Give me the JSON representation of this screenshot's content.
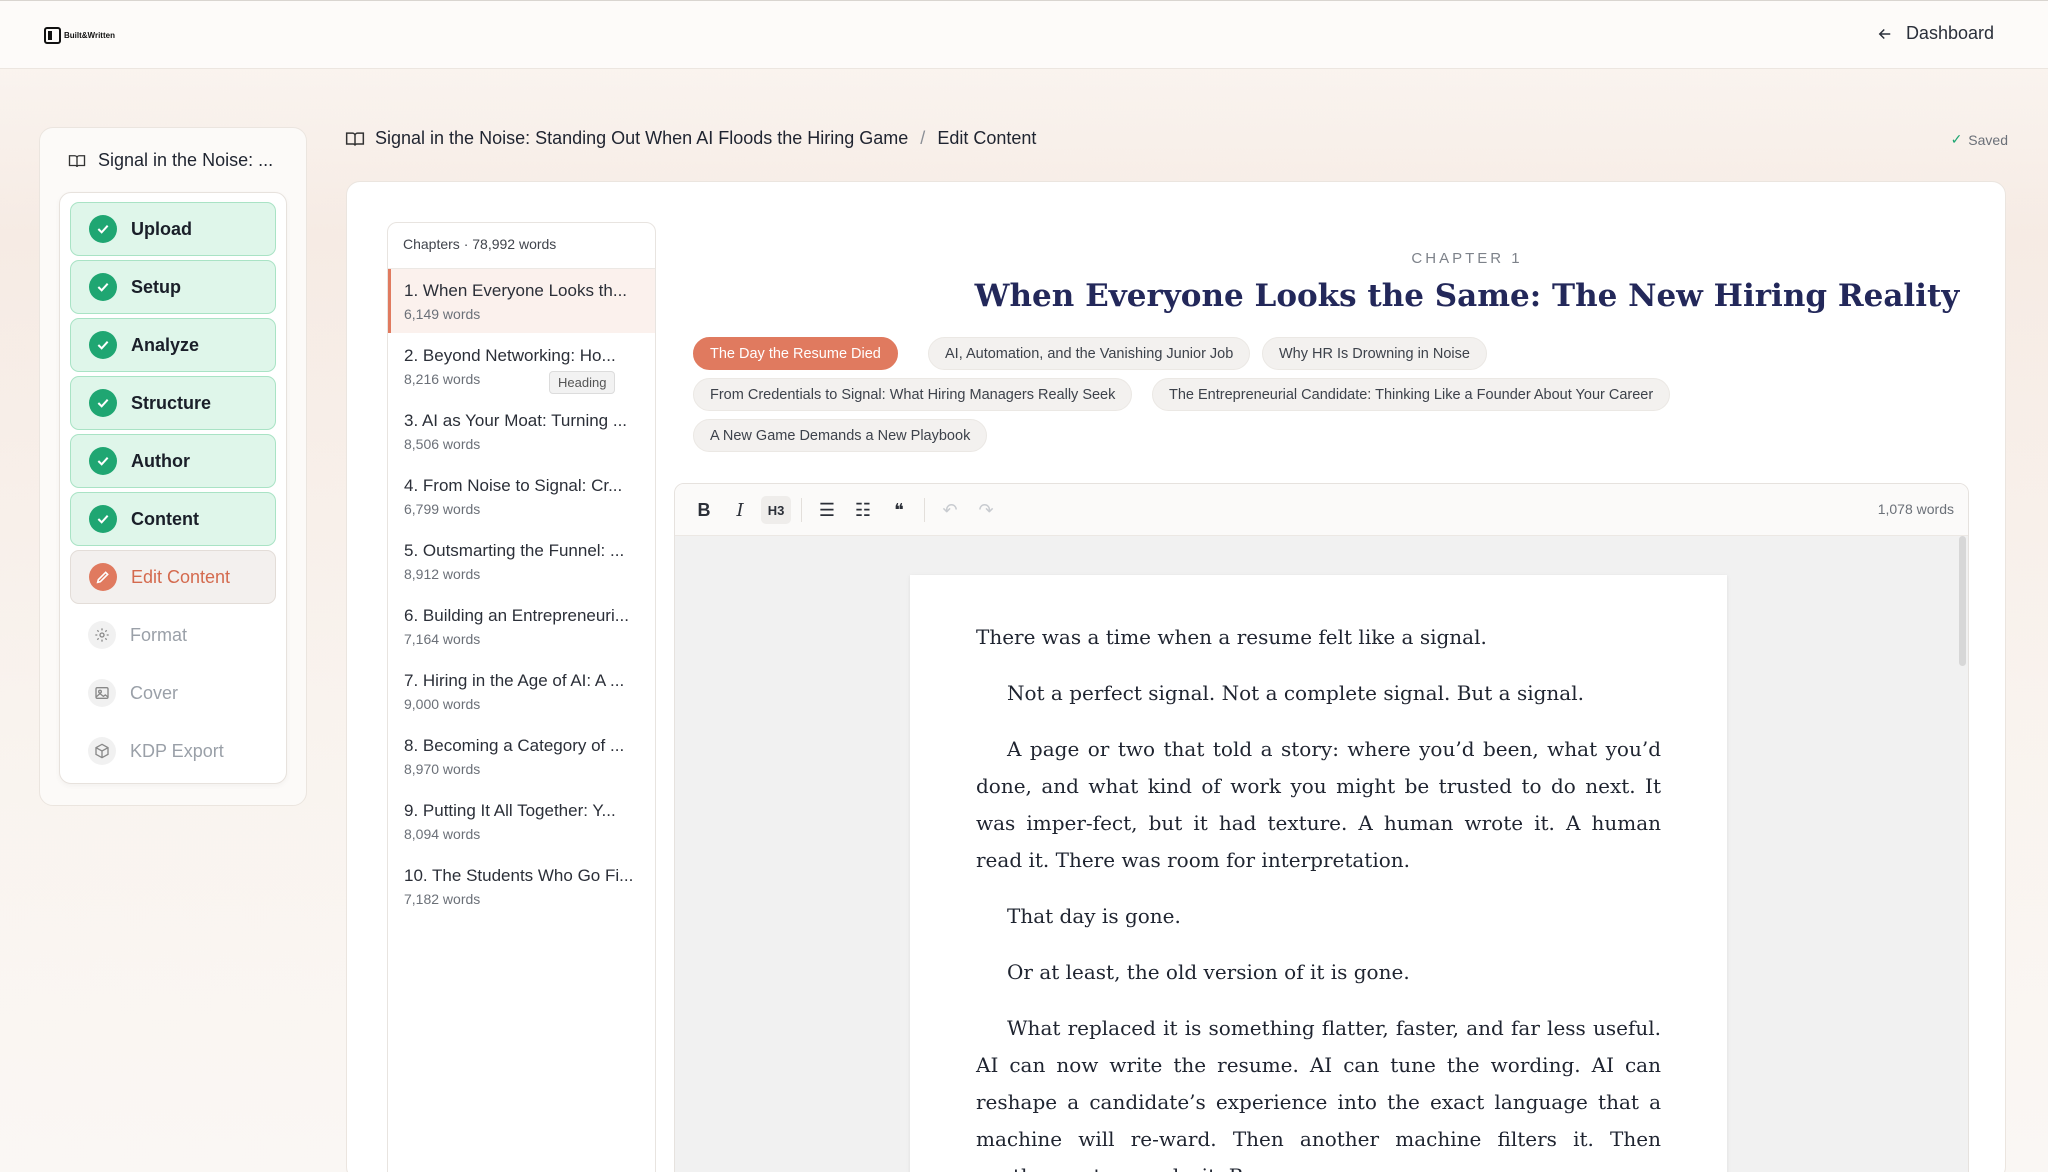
{
  "brand": {
    "name": "Built&Written"
  },
  "topbar": {
    "dashboard_label": "Dashboard"
  },
  "sidebar": {
    "book_title": "Signal in the Noise: ...",
    "steps": [
      {
        "label": "Upload",
        "state": "done"
      },
      {
        "label": "Setup",
        "state": "done"
      },
      {
        "label": "Analyze",
        "state": "done"
      },
      {
        "label": "Structure",
        "state": "done"
      },
      {
        "label": "Author",
        "state": "done"
      },
      {
        "label": "Content",
        "state": "done"
      },
      {
        "label": "Edit Content",
        "state": "active"
      },
      {
        "label": "Format",
        "state": "todo",
        "icon": "gear-icon"
      },
      {
        "label": "Cover",
        "state": "todo",
        "icon": "image-icon"
      },
      {
        "label": "KDP Export",
        "state": "todo",
        "icon": "package-icon"
      }
    ]
  },
  "breadcrumb": {
    "book": "Signal in the Noise: Standing Out When AI Floods the Hiring Game",
    "separator": "/",
    "current": "Edit Content"
  },
  "status": {
    "saved": "Saved"
  },
  "chapters": {
    "header": "Chapters · 78,992 words",
    "items": [
      {
        "title": "1. When Everyone Looks th...",
        "words": "6,149 words"
      },
      {
        "title": "2. Beyond Networking: Ho...",
        "words": "8,216 words"
      },
      {
        "title": "3. AI as Your Moat: Turning ...",
        "words": "8,506 words"
      },
      {
        "title": "4. From Noise to Signal: Cr...",
        "words": "6,799 words"
      },
      {
        "title": "5. Outsmarting the Funnel: ...",
        "words": "8,912 words"
      },
      {
        "title": "6. Building an Entrepreneuri...",
        "words": "7,164 words"
      },
      {
        "title": "7. Hiring in the Age of AI: A ...",
        "words": "9,000 words"
      },
      {
        "title": "8. Becoming a Category of ...",
        "words": "8,970 words"
      },
      {
        "title": "9. Putting It All Together: Y...",
        "words": "8,094 words"
      },
      {
        "title": "10. The Students Who Go Fi...",
        "words": "7,182 words"
      }
    ],
    "tooltip": "Heading"
  },
  "chapter": {
    "label": "CHAPTER 1",
    "title": "When Everyone Looks the Same: The New Hiring Reality",
    "sections": [
      "The Day the Resume Died",
      "AI, Automation, and the Vanishing Junior Job",
      "Why HR Is Drowning in Noise",
      "From Credentials to Signal: What Hiring Managers Really Seek",
      "The Entrepreneurial Candidate: Thinking Like a Founder About Your Career",
      "A New Game Demands a New Playbook"
    ]
  },
  "editor": {
    "word_count": "1,078 words",
    "toolbar": {
      "bold": "B",
      "italic": "I",
      "heading": "H3",
      "bullet": "☰",
      "ordered": "☷",
      "quote": "❝",
      "undo": "↶",
      "redo": "↷"
    },
    "paragraphs": [
      "There was a time when a resume felt like a signal.",
      "Not a perfect signal. Not a complete signal. But a signal.",
      "A page or two that told a story: where you’d been, what you’d done, and what kind of work you might be trusted to do next. It was imper-fect, but it had texture. A human wrote it. A human read it. There was room for interpretation.",
      "That day is gone.",
      "Or at least, the old version of it is gone.",
      "What replaced it is something flatter, faster, and far less useful. AI can now write the resume. AI can tune the wording. AI can reshape a candidate’s experience into the exact language that a machine will re-ward. Then another machine filters it. Then another system ranks it. By"
    ]
  },
  "colors": {
    "accent": "#e07a5f",
    "success": "#1fa672",
    "title": "#23285a"
  }
}
